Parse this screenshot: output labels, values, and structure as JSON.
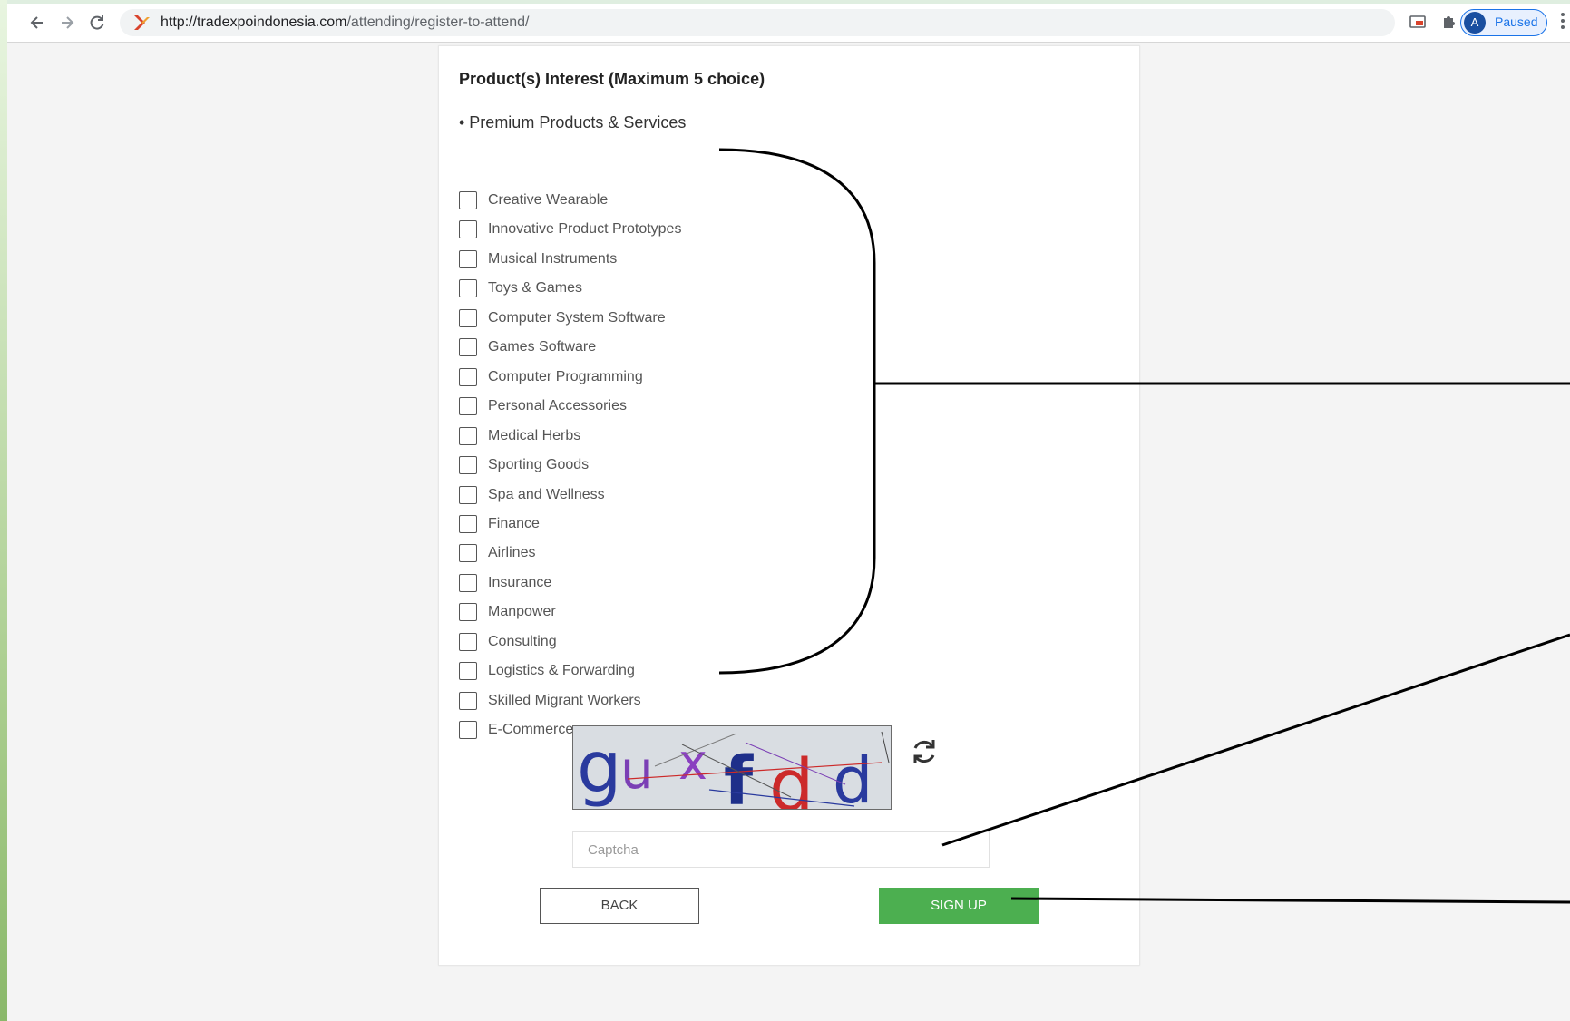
{
  "browser": {
    "url_host": "http://tradexpoindonesia.com",
    "url_path": "/attending/register-to-attend/",
    "profile_initial": "A",
    "profile_status": "Paused",
    "icons": [
      "back-icon",
      "forward-icon",
      "reload-icon",
      "site-icon",
      "cast-icon",
      "puzzle-icon",
      "kebab-icon"
    ]
  },
  "form": {
    "title": "Product(s) Interest (Maximum 5 choice)",
    "section_label": "• Premium Products & Services",
    "options": [
      "Creative Wearable",
      "Innovative Product Prototypes",
      "Musical Instruments",
      "Toys & Games",
      "Computer System Software",
      "Games Software",
      "Computer Programming",
      "Personal Accessories",
      "Medical Herbs",
      "Sporting Goods",
      "Spa and Wellness",
      "Finance",
      "Airlines",
      "Insurance",
      "Manpower",
      "Consulting",
      "Logistics & Forwarding",
      "Skilled Migrant Workers",
      "E-Commerce"
    ],
    "captcha_text": [
      "g",
      "u",
      "x",
      "f",
      "d",
      "d"
    ],
    "captcha_placeholder": "Captcha",
    "back_label": "BACK",
    "signup_label": "SIGN UP"
  },
  "colors": {
    "signup_green": "#4caf50",
    "captcha_blue": "#2a3a9e",
    "captcha_purple": "#7b3fb5",
    "captcha_red": "#cc2a2a",
    "captcha_navy": "#1e2f8a"
  }
}
